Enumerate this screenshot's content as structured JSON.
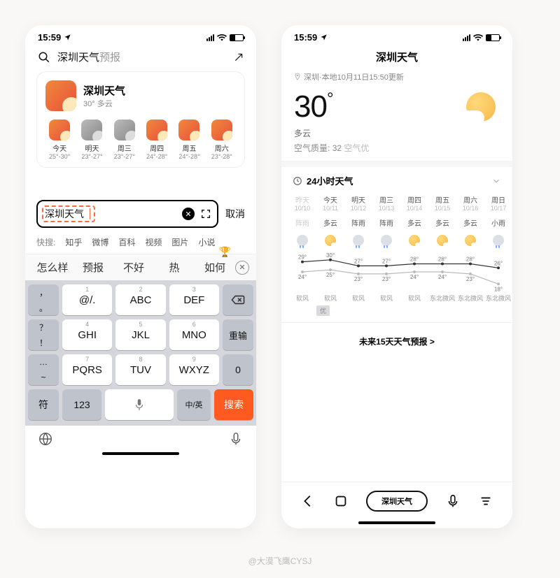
{
  "status": {
    "time": "15:59",
    "locationArrow": true
  },
  "left": {
    "search": {
      "query_emphasis": "深圳天气",
      "query_tail": "预报"
    },
    "card": {
      "title": "深圳天气",
      "sub": "30° 多云",
      "days": [
        {
          "label": "今天",
          "range": "25°-30°",
          "icon": "sunny"
        },
        {
          "label": "明天",
          "range": "23°-27°",
          "icon": "cloud"
        },
        {
          "label": "周三",
          "range": "23°-27°",
          "icon": "cloud"
        },
        {
          "label": "周四",
          "range": "24°-28°",
          "icon": "sunny"
        },
        {
          "label": "周五",
          "range": "24°-28°",
          "icon": "sunny"
        },
        {
          "label": "周六",
          "range": "23°-28°",
          "icon": "sunny"
        }
      ]
    },
    "input": {
      "value": "深圳天气",
      "cancel": "取消"
    },
    "quick": {
      "label": "快搜:",
      "items": [
        "知乎",
        "微博",
        "百科",
        "视频",
        "图片",
        "小说"
      ]
    },
    "candidates": [
      "怎么样",
      "预报",
      "不好",
      "热",
      "如何"
    ],
    "keyboard": {
      "row1_side_left": [
        "，",
        "。"
      ],
      "row1": [
        {
          "n": "1",
          "t": "@/."
        },
        {
          "n": "2",
          "t": "ABC"
        },
        {
          "n": "3",
          "t": "DEF"
        }
      ],
      "row1_side_right": "delete-icon",
      "row2_side_left": [
        "？",
        "！"
      ],
      "row2": [
        {
          "n": "4",
          "t": "GHI"
        },
        {
          "n": "5",
          "t": "JKL"
        },
        {
          "n": "6",
          "t": "MNO"
        }
      ],
      "row2_side_right": "重输",
      "row3_side_left": [
        "…",
        "~"
      ],
      "row3": [
        {
          "n": "7",
          "t": "PQRS"
        },
        {
          "n": "8",
          "t": "TUV"
        },
        {
          "n": "9",
          "t": "WXYZ"
        }
      ],
      "row3_side_right": "0",
      "row4": {
        "sym": "符",
        "num": "123",
        "mic": "mic-icon",
        "ime": "中/英",
        "search": "搜索"
      }
    }
  },
  "right": {
    "title": "深圳天气",
    "loc": "深圳·本地10月11日15:50更新",
    "temp": "30",
    "cond": "多云",
    "aqi_label": "空气质量:",
    "aqi_value": "32",
    "aqi_text": "空气优",
    "section24": "24小时天气",
    "forecast": {
      "days": [
        {
          "d": "昨天",
          "date": "10/10",
          "cond": "阵雨",
          "icon": "rain",
          "hi": 29,
          "lo": 24,
          "wind": "软风",
          "dim": true
        },
        {
          "d": "今天",
          "date": "10/11",
          "cond": "多云",
          "icon": "pc",
          "hi": 30,
          "lo": 25,
          "wind": "软风"
        },
        {
          "d": "明天",
          "date": "10/12",
          "cond": "阵雨",
          "icon": "rain",
          "hi": 27,
          "lo": 23,
          "wind": "软风"
        },
        {
          "d": "周三",
          "date": "10/13",
          "cond": "阵雨",
          "icon": "rain",
          "hi": 27,
          "lo": 23,
          "wind": "软风"
        },
        {
          "d": "周四",
          "date": "10/14",
          "cond": "多云",
          "icon": "pc",
          "hi": 28,
          "lo": 24,
          "wind": "软风"
        },
        {
          "d": "周五",
          "date": "10/15",
          "cond": "多云",
          "icon": "pc",
          "hi": 28,
          "lo": 24,
          "wind": "东北微风"
        },
        {
          "d": "周六",
          "date": "10/16",
          "cond": "多云",
          "icon": "pc",
          "hi": 28,
          "lo": 23,
          "wind": "东北微风"
        },
        {
          "d": "周日",
          "date": "10/17",
          "cond": "小雨",
          "icon": "rain",
          "hi": 26,
          "lo": 18,
          "wind": "东北微风"
        }
      ],
      "badge": "优"
    },
    "future": "未来15天天气预报 >",
    "bottom_pill": "深圳天气"
  },
  "credit": "@大漠飞鹰CYSJ",
  "chart_data": {
    "type": "line",
    "title": "8-day high/low temperature",
    "categories": [
      "10/10",
      "10/11",
      "10/12",
      "10/13",
      "10/14",
      "10/15",
      "10/16",
      "10/17"
    ],
    "series": [
      {
        "name": "high",
        "values": [
          29,
          30,
          27,
          27,
          28,
          28,
          28,
          26
        ]
      },
      {
        "name": "low",
        "values": [
          24,
          25,
          23,
          23,
          24,
          24,
          23,
          18
        ]
      }
    ],
    "ylim": [
      16,
      32
    ],
    "xlabel": "",
    "ylabel": "°"
  }
}
